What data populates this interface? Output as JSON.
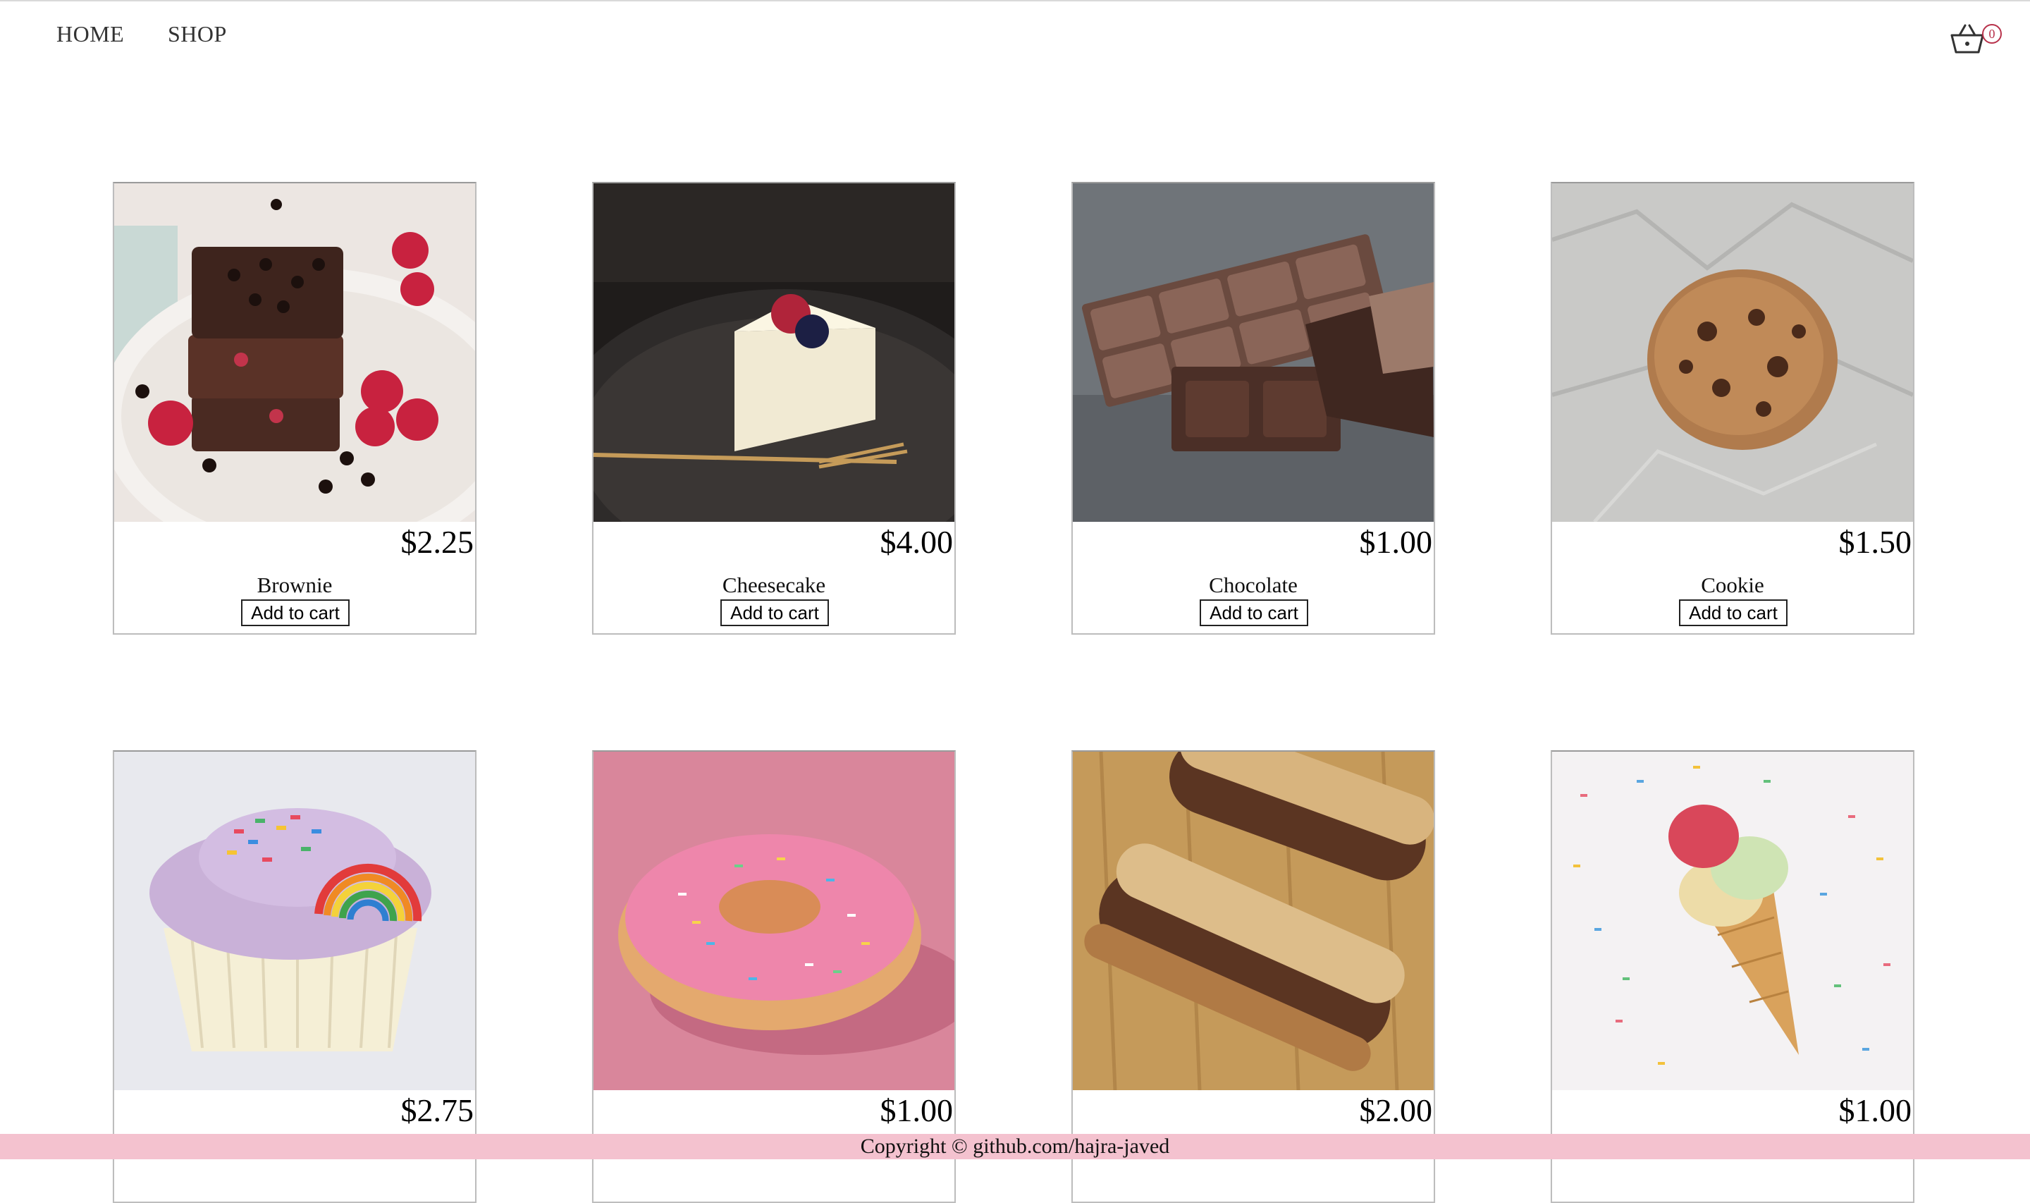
{
  "nav": {
    "home": "HOME",
    "shop": "SHOP",
    "cart_count": "0"
  },
  "products": [
    {
      "name": "Brownie",
      "price": "$2.25",
      "button": "Add to cart"
    },
    {
      "name": "Cheesecake",
      "price": "$4.00",
      "button": "Add to cart"
    },
    {
      "name": "Chocolate",
      "price": "$1.00",
      "button": "Add to cart"
    },
    {
      "name": "Cookie",
      "price": "$1.50",
      "button": "Add to cart"
    },
    {
      "name": "",
      "price": "$2.75",
      "button": ""
    },
    {
      "name": "",
      "price": "$1.00",
      "button": ""
    },
    {
      "name": "",
      "price": "$2.00",
      "button": ""
    },
    {
      "name": "",
      "price": "$1.00",
      "button": ""
    }
  ],
  "footer": {
    "text": "Copyright © github.com/hajra-javed"
  },
  "colors": {
    "footer_bg": "#f4c2cf",
    "badge": "#b8324b"
  }
}
